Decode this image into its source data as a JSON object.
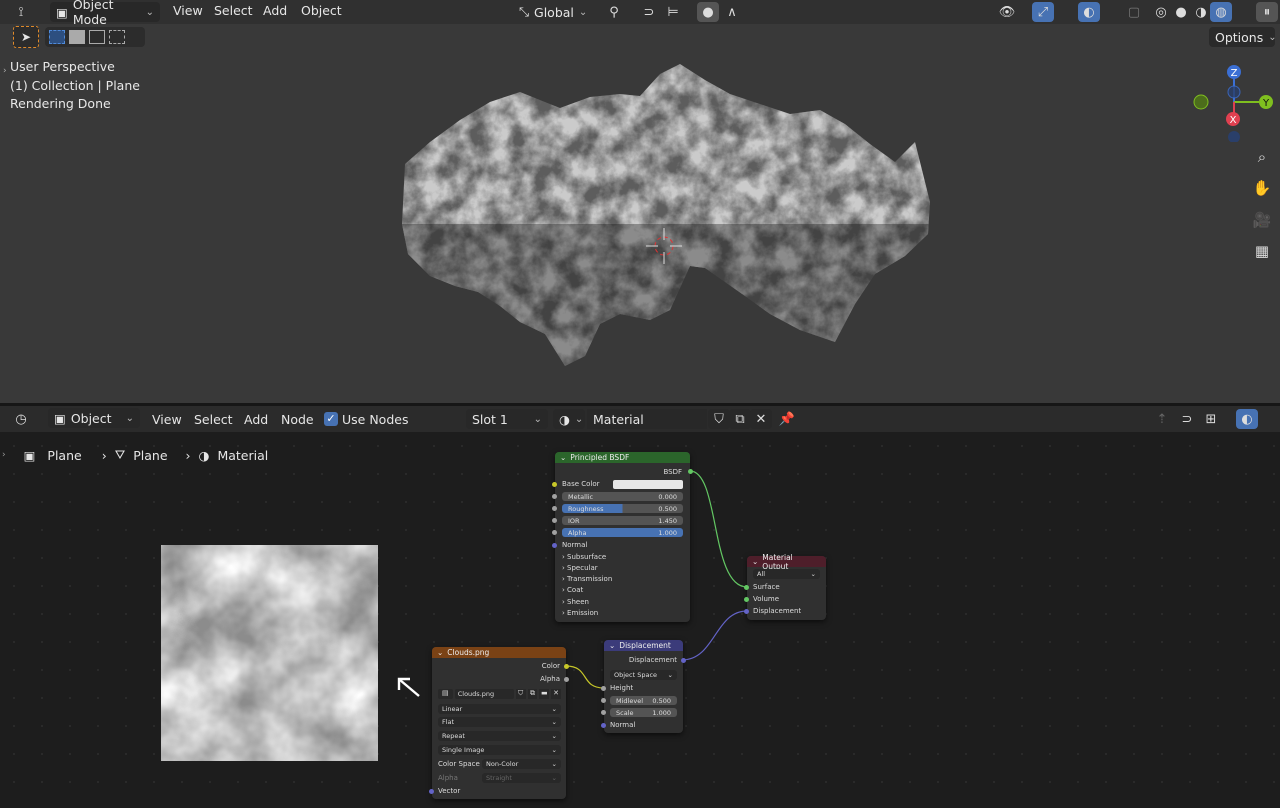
{
  "top_header": {
    "mode": "Object Mode",
    "menus": [
      "View",
      "Select",
      "Add",
      "Object"
    ],
    "transform_orientation": "Global",
    "options_label": "Options"
  },
  "viewport": {
    "overlay_lines": [
      "User Perspective",
      "(1) Collection | Plane",
      "Rendering Done"
    ],
    "gizmo": {
      "z": "Z",
      "y": "Y",
      "x": "X"
    }
  },
  "node_header": {
    "editor_type": "Object",
    "menus": [
      "View",
      "Select",
      "Add",
      "Node"
    ],
    "use_nodes_label": "Use Nodes",
    "slot": "Slot 1",
    "material_name": "Material"
  },
  "breadcrumb": [
    "Plane",
    "Plane",
    "Material"
  ],
  "nodes": {
    "principled": {
      "title": "Principled BSDF",
      "output": "BSDF",
      "base_color_label": "Base Color",
      "fields": [
        {
          "label": "Metallic",
          "value": "0.000",
          "fill": 0
        },
        {
          "label": "Roughness",
          "value": "0.500",
          "fill": 0.5
        },
        {
          "label": "IOR",
          "value": "1.450",
          "fill": 0
        },
        {
          "label": "Alpha",
          "value": "1.000",
          "fill": 1
        }
      ],
      "normal_label": "Normal",
      "panels": [
        "Subsurface",
        "Specular",
        "Transmission",
        "Coat",
        "Sheen",
        "Emission"
      ]
    },
    "material_output": {
      "title": "Material Output",
      "target": "All",
      "inputs": [
        "Surface",
        "Volume",
        "Displacement"
      ]
    },
    "displacement": {
      "title": "Displacement",
      "output": "Displacement",
      "space": "Object Space",
      "height_label": "Height",
      "midlevel_label": "Midlevel",
      "midlevel_value": "0.500",
      "scale_label": "Scale",
      "scale_value": "1.000",
      "normal_label": "Normal"
    },
    "image": {
      "title": "Clouds.png",
      "outputs": [
        "Color",
        "Alpha"
      ],
      "image_name": "Clouds.png",
      "interpolation": "Linear",
      "projection": "Flat",
      "extension": "Repeat",
      "source": "Single Image",
      "color_space_label": "Color Space",
      "color_space": "Non-Color",
      "alpha_label": "Alpha",
      "alpha_mode": "Straight",
      "vector_label": "Vector"
    }
  },
  "colors": {
    "accent_blue": "#4772b3",
    "shader_header": "#2b652b",
    "output_header": "#4e1e2a",
    "vector_header": "#3b3b7a",
    "texture_header": "#7a4215"
  }
}
